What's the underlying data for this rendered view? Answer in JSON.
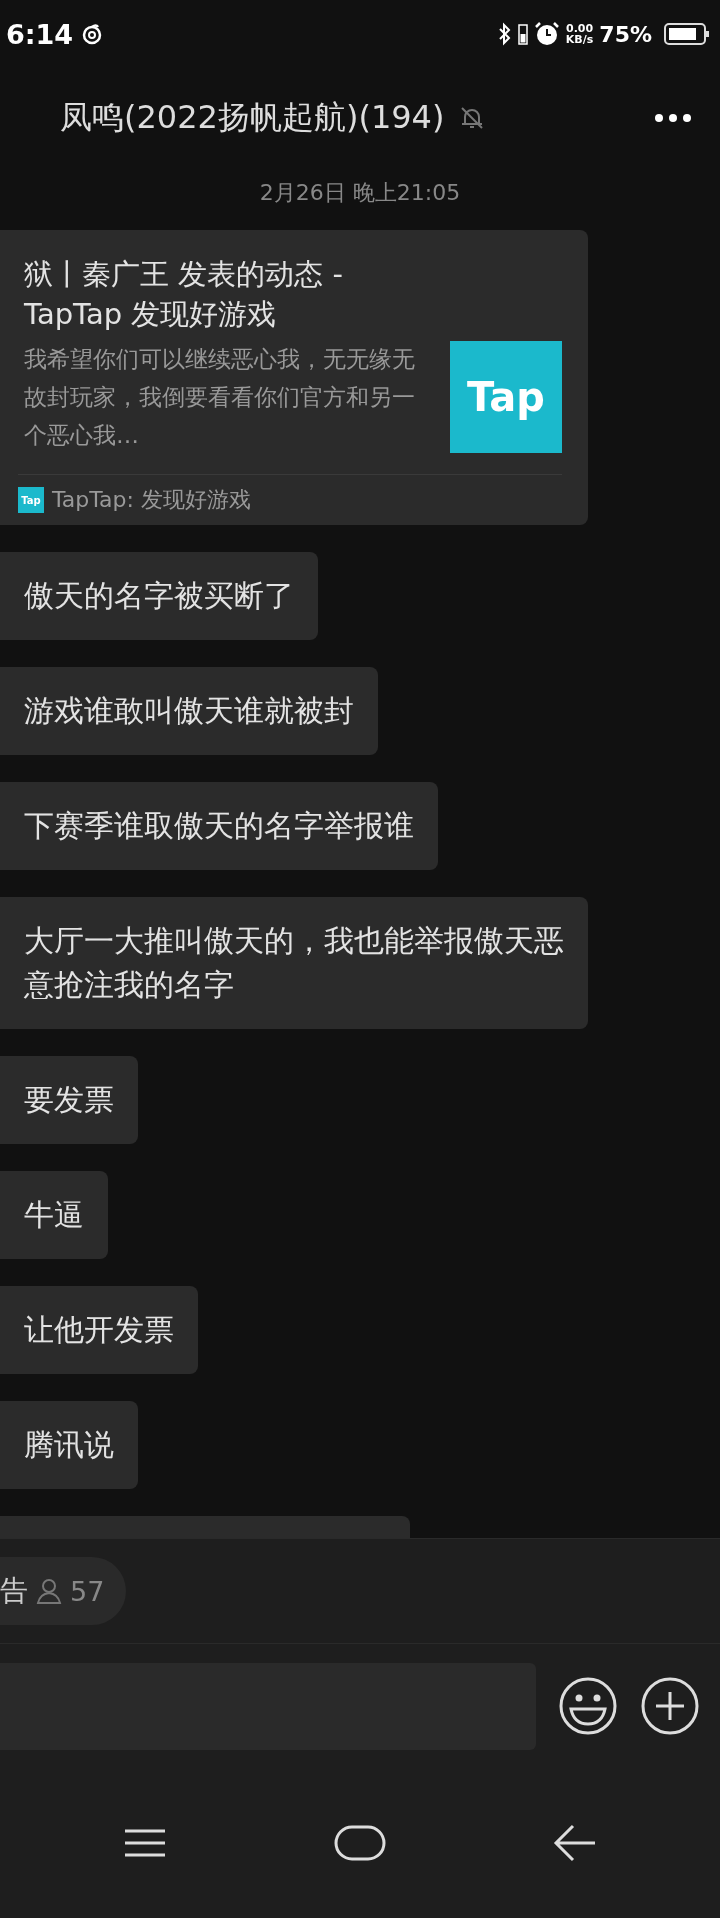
{
  "status_bar": {
    "time": "6:14",
    "net_speed": "0.00",
    "net_unit": "KB/s",
    "battery_text": "75%"
  },
  "header": {
    "title": "凤鸣(2022扬帆起航)(194)",
    "muted": true
  },
  "date_divider": "2月26日 晚上21:05",
  "messages": [
    {
      "kind": "link_card",
      "title": "狱丨秦广王 发表的动态 - TapTap 发现好游戏",
      "description": "我希望你们可以继续恶心我，无无缘无故封玩家，我倒要看看你们官方和另一个恶心我…",
      "thumb_text": "Tap",
      "source_icon_text": "Tap",
      "source": "TapTap: 发现好游戏"
    },
    {
      "kind": "text",
      "text": "傲天的名字被买断了"
    },
    {
      "kind": "text",
      "text": "游戏谁敢叫傲天谁就被封"
    },
    {
      "kind": "text",
      "text": "下赛季谁取傲天的名字举报谁"
    },
    {
      "kind": "text",
      "text": "大厅一大推叫傲天的，我也能举报傲天恶意抢注我的名字"
    },
    {
      "kind": "text",
      "text": "要发票"
    },
    {
      "kind": "text",
      "text": "牛逼"
    },
    {
      "kind": "text",
      "text": "让他开发票"
    },
    {
      "kind": "text",
      "text": "腾讯说"
    },
    {
      "kind": "cut"
    }
  ],
  "notice": {
    "label": "告",
    "count": "57"
  }
}
